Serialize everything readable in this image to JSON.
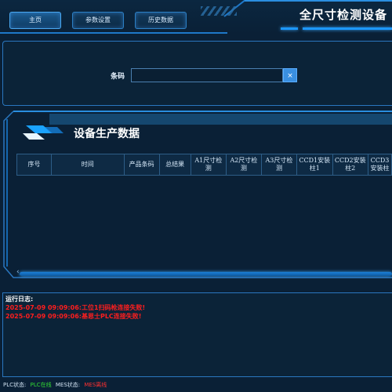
{
  "header": {
    "title": "全尺寸检测设备",
    "nav": [
      {
        "label": "主页"
      },
      {
        "label": "参数设置"
      },
      {
        "label": "历史数据"
      }
    ]
  },
  "barcode": {
    "label": "条码",
    "value": "",
    "clear_icon": "×"
  },
  "production": {
    "title": "设备生产数据",
    "columns": [
      "序号",
      "时间",
      "产品条码",
      "总结果",
      "A1尺寸检测",
      "A2尺寸检测",
      "A3尺寸检测",
      "CCD1安装柱1",
      "CCD2安装柱2",
      "CCD3安装柱"
    ],
    "rows": []
  },
  "log": {
    "title": "运行日志:",
    "entries": [
      "2025-07-09 09:09:06:工位1扫码枪连接失败!",
      "2025-07-09 09:09:06:基恩士PLC连接失败!"
    ]
  },
  "status": {
    "plc_label": "PLC状态:",
    "plc_value": "PLC在线",
    "mes_label": "MES状态:",
    "mes_value": "MES离线",
    "plc_color": "#33dd33",
    "mes_color": "#ff3030"
  },
  "colors": {
    "accent": "#1c97ff",
    "log_error": "#ff1e1e",
    "background": "#0a2036"
  }
}
